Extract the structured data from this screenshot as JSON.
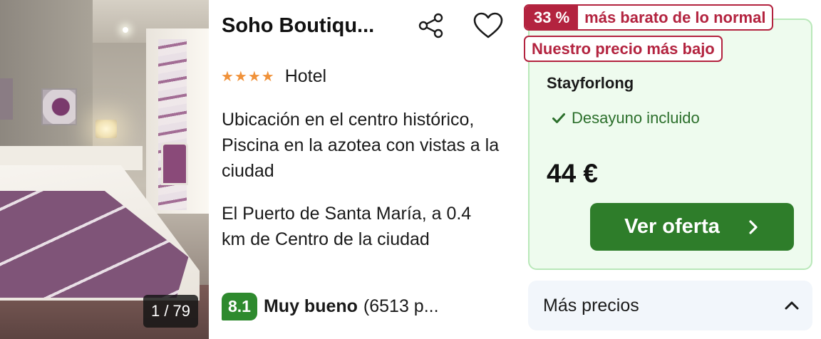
{
  "photo": {
    "counter": "1 / 79"
  },
  "hotel": {
    "name": "Soho Boutiqu...",
    "stars": "★★★★",
    "star_count": 4,
    "type": "Hotel",
    "highlights": "Ubicación en el centro histórico, Piscina en la azotea con vistas a la ciudad",
    "location": "El Puerto de Santa María, a 0.4 km de Centro de la ciudad"
  },
  "review": {
    "score": "8.1",
    "label": "Muy bueno",
    "count_text": "(6513 p..."
  },
  "deal": {
    "discount_pct": "33 %",
    "discount_text": "más barato de lo normal",
    "lowest_badge": "Nuestro precio más bajo",
    "provider": "Stayforlong",
    "amenity": "Desayuno incluido",
    "price": "44 €",
    "cta_label": "Ver oferta"
  },
  "more_prices": {
    "label": "Más precios"
  },
  "colors": {
    "accent_green": "#2e7d2a",
    "score_green": "#2e8a2e",
    "deal_red": "#b3233f",
    "star_orange": "#f0923a",
    "deal_bg": "#eefbee"
  },
  "icons": [
    "share-icon",
    "heart-icon",
    "check-icon",
    "chevron-right-icon",
    "chevron-up-icon"
  ]
}
